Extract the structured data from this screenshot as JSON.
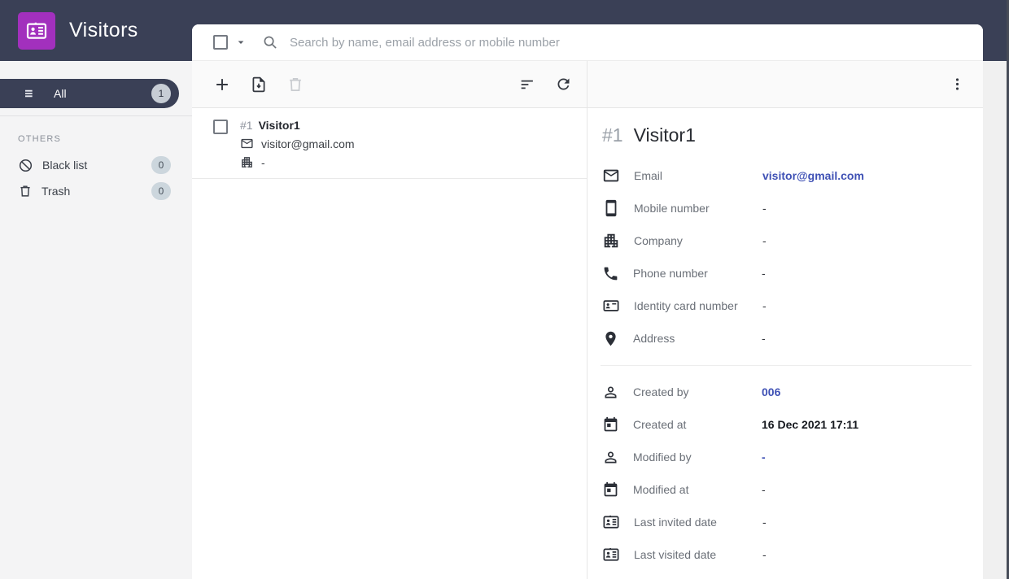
{
  "app": {
    "title": "Visitors",
    "logo_icon": "id-card-icon"
  },
  "colors": {
    "header_bg": "#3a4056",
    "brand_purple": "#a230bd",
    "link_blue": "#3f51b5",
    "sidebar_bg": "#f4f4f5",
    "badge_bg": "#ccd6dd",
    "toolbar_bg": "#fafafa"
  },
  "sidebar": {
    "all": {
      "label": "All",
      "count": "1",
      "icon": "list-icon"
    },
    "section_label": "OTHERS",
    "items": [
      {
        "label": "Black list",
        "count": "0",
        "icon": "block-icon"
      },
      {
        "label": "Trash",
        "count": "0",
        "icon": "trash-icon"
      }
    ]
  },
  "search": {
    "placeholder": "Search by name, email address or mobile number",
    "icons": [
      "select-checkbox",
      "caret-down-icon",
      "search-icon"
    ]
  },
  "toolbar": {
    "list_icons": [
      "add-icon",
      "import-file-icon",
      "delete-icon",
      "sort-icon",
      "refresh-icon"
    ],
    "detail_icons": [
      "more-vert-icon"
    ]
  },
  "list": {
    "items": [
      {
        "id": "#1",
        "name": "Visitor1",
        "email": "visitor@gmail.com",
        "company": "-",
        "icons": [
          "mail-icon",
          "company-icon"
        ]
      }
    ]
  },
  "detail": {
    "id": "#1",
    "name": "Visitor1",
    "fields": [
      {
        "icon": "mail-icon",
        "label": "Email",
        "value": "visitor@gmail.com"
      },
      {
        "icon": "smartphone-icon",
        "label": "Mobile number",
        "value": "-"
      },
      {
        "icon": "company-icon",
        "label": "Company",
        "value": "-"
      },
      {
        "icon": "phone-icon",
        "label": "Phone number",
        "value": "-"
      },
      {
        "icon": "id-badge-icon",
        "label": "Identity card number",
        "value": "-"
      },
      {
        "icon": "location-icon",
        "label": "Address",
        "value": "-"
      }
    ],
    "meta": [
      {
        "icon": "person-icon",
        "label": "Created by",
        "value": "006"
      },
      {
        "icon": "calendar-icon",
        "label": "Created at",
        "value": "16 Dec 2021 17:11"
      },
      {
        "icon": "person-icon",
        "label": "Modified by",
        "value": "-"
      },
      {
        "icon": "calendar-icon",
        "label": "Modified at",
        "value": "-"
      },
      {
        "icon": "contact-card-icon",
        "label": "Last invited date",
        "value": "-"
      },
      {
        "icon": "contact-card-icon",
        "label": "Last visited date",
        "value": "-"
      }
    ]
  }
}
